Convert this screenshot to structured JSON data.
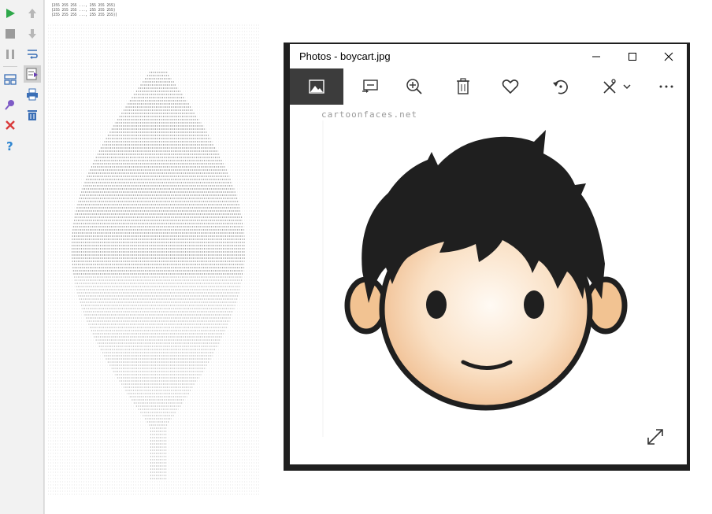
{
  "ide": {
    "toolbar": [
      {
        "name": "run-button",
        "icon": "play-icon",
        "color": "#2ea84a"
      },
      {
        "name": "scroll-up-button",
        "icon": "arrow-up-icon",
        "color": "#9a9a9a"
      },
      {
        "name": "stop-button",
        "icon": "stop-icon",
        "color": "#8c8c8c"
      },
      {
        "name": "scroll-down-button",
        "icon": "arrow-down-icon",
        "color": "#9a9a9a"
      },
      {
        "name": "pause-button",
        "icon": "pause-icon",
        "color": "#8c8c8c"
      },
      {
        "name": "soft-wrap-button",
        "icon": "wrap-icon",
        "color": "#3b6fb6"
      },
      {
        "name": "layout-button",
        "icon": "layout-icon",
        "color": "#3b6fb6"
      },
      {
        "name": "scroll-to-end-button",
        "icon": "scroll-end-icon",
        "color": "#6a3fb3"
      },
      {
        "name": "print-button",
        "icon": "print-icon",
        "color": "#3b6fb6"
      },
      {
        "name": "pin-button",
        "icon": "pin-icon",
        "color": "#7e5bc6"
      },
      {
        "name": "clear-button",
        "icon": "trash-icon",
        "color": "#3b6fb6"
      },
      {
        "name": "close-button",
        "icon": "close-icon",
        "color": "#d93a3a"
      },
      {
        "name": "help-button",
        "icon": "help-icon",
        "color": "#2f86d1"
      }
    ],
    "console": {
      "lines": [
        "[255 255 255 ..., 255 255 255]",
        "[255 255 255 ..., 255 255 255]",
        "[255 255 255 ..., 255 255 255]]"
      ]
    }
  },
  "photos": {
    "title": "Photos - boycart.jpg",
    "watermark": "cartoonfaces.net",
    "commands": [
      {
        "name": "view-image-button",
        "icon": "image-icon"
      },
      {
        "name": "slideshow-button",
        "icon": "slideshow-icon"
      },
      {
        "name": "zoom-button",
        "icon": "zoom-in-icon"
      },
      {
        "name": "delete-button",
        "icon": "trash-icon"
      },
      {
        "name": "favorite-button",
        "icon": "heart-icon"
      },
      {
        "name": "rotate-button",
        "icon": "rotate-icon"
      },
      {
        "name": "edit-button",
        "icon": "edit-create-icon"
      },
      {
        "name": "more-button",
        "icon": "more-icon"
      }
    ],
    "window_buttons": [
      "minimize-icon",
      "maximize-icon",
      "close-icon"
    ]
  }
}
